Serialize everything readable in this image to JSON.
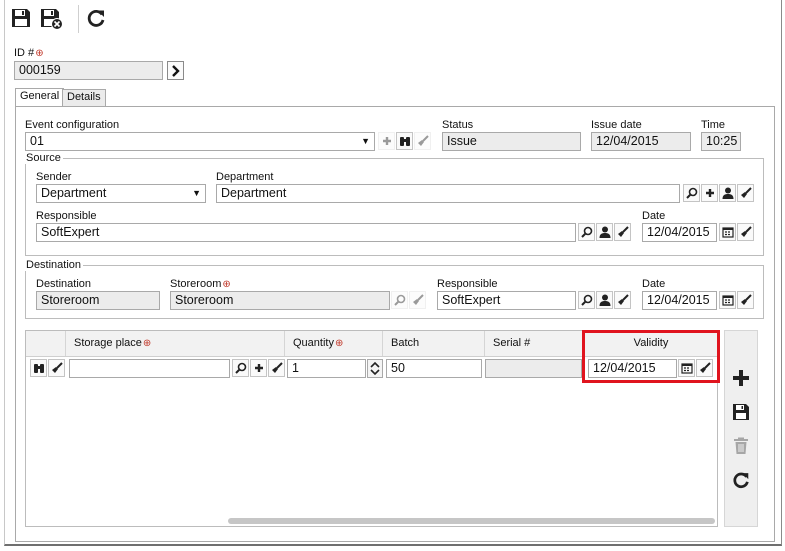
{
  "toolbar": {
    "save_icon": "floppy-disk-icon",
    "save_close_icon": "floppy-disk-close-icon",
    "refresh_icon": "refresh-icon"
  },
  "id_field": {
    "label": "ID #",
    "value": "000159"
  },
  "tabs": [
    {
      "label": "General",
      "active": true
    },
    {
      "label": "Details",
      "active": false
    }
  ],
  "general": {
    "event_configuration": {
      "label": "Event configuration",
      "value": "01"
    },
    "status": {
      "label": "Status",
      "value": "Issue"
    },
    "issue_date": {
      "label": "Issue date",
      "value": "12/04/2015"
    },
    "time": {
      "label": "Time",
      "value": "10:25"
    }
  },
  "source": {
    "title": "Source",
    "sender": {
      "label": "Sender",
      "value": "Department"
    },
    "department": {
      "label": "Department",
      "value": "Department"
    },
    "responsible": {
      "label": "Responsible",
      "value": "SoftExpert"
    },
    "date": {
      "label": "Date",
      "value": "12/04/2015"
    }
  },
  "destination": {
    "title": "Destination",
    "destination": {
      "label": "Destination",
      "value": "Storeroom"
    },
    "storeroom": {
      "label": "Storeroom",
      "value": "Storeroom"
    },
    "responsible": {
      "label": "Responsible",
      "value": "SoftExpert"
    },
    "date": {
      "label": "Date",
      "value": "12/04/2015"
    }
  },
  "grid": {
    "columns": {
      "storage_place": "Storage place",
      "quantity": "Quantity",
      "batch": "Batch",
      "serial": "Serial #",
      "validity": "Validity"
    },
    "row": {
      "storage_place": "",
      "quantity": "1",
      "batch": "50",
      "serial": "",
      "validity": "12/04/2015"
    }
  },
  "highlight_color": "#e0141e"
}
